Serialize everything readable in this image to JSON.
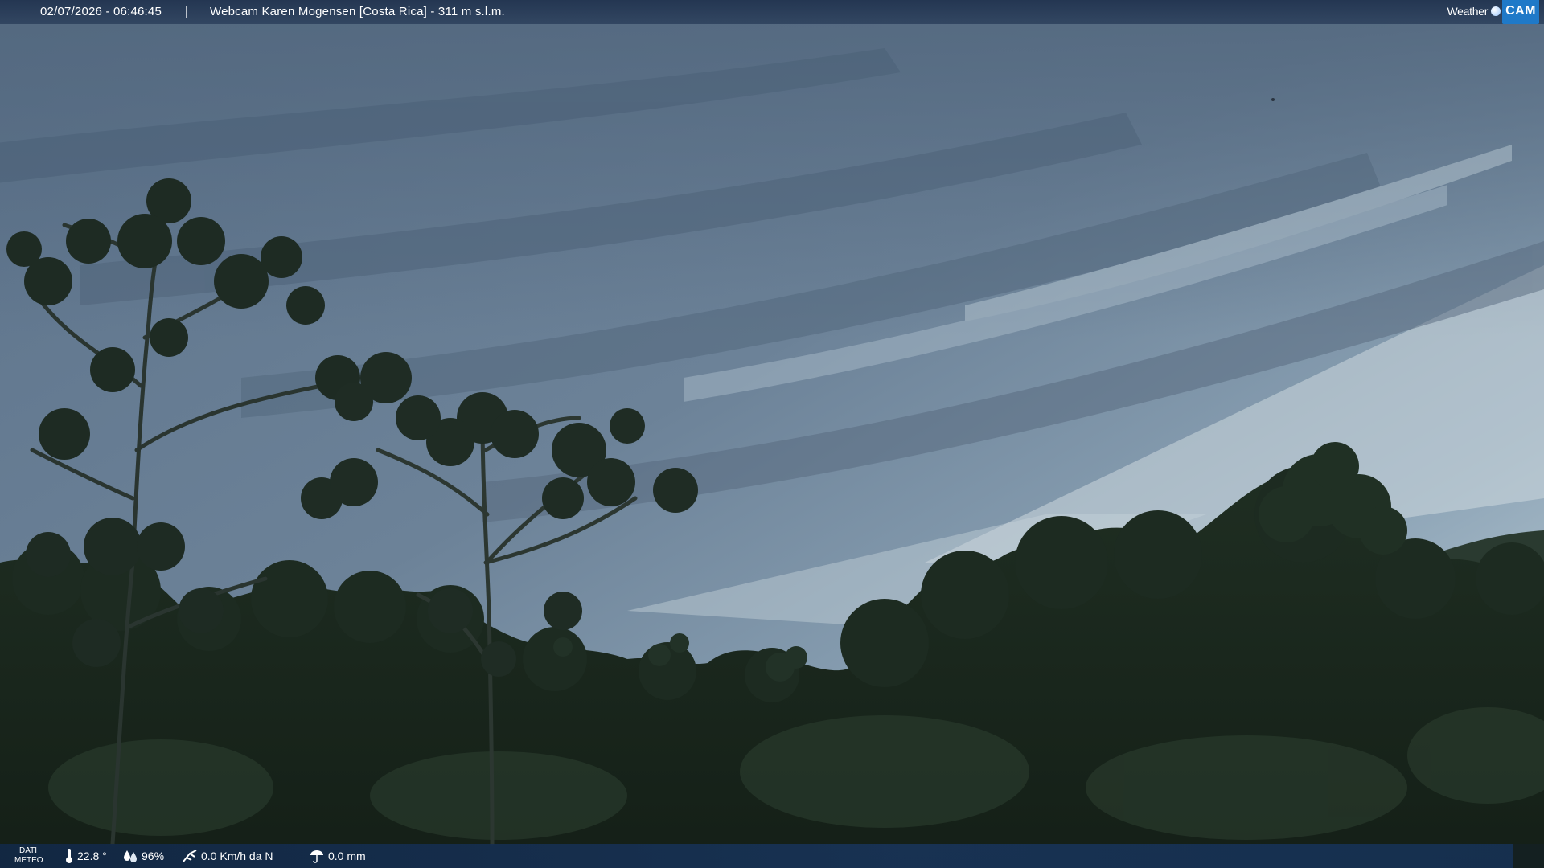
{
  "overlay": {
    "timestamp": "02/07/2026 - 06:46:45",
    "separator": "|",
    "title": "Webcam Karen Mogensen [Costa Rica] - 311 m s.l.m.",
    "logo_left": "Weather",
    "logo_right": "CAM",
    "brand_color": "#1f79c8"
  },
  "weather": {
    "label_line1": "DATI",
    "label_line2": "METEO",
    "temperature": "22.8 °",
    "humidity": "96%",
    "wind": "0.0 Km/h da N",
    "rain": "0.0 mm",
    "icons": [
      "thermometer-icon",
      "humidity-icon",
      "wind-icon",
      "rain-icon"
    ]
  },
  "scene": {
    "subject": "overcast dawn sky over tropical forest",
    "sky_colors": [
      "#5f7690",
      "#8aa2b8",
      "#c9d6de"
    ],
    "foliage_color": "#1c2a20"
  }
}
